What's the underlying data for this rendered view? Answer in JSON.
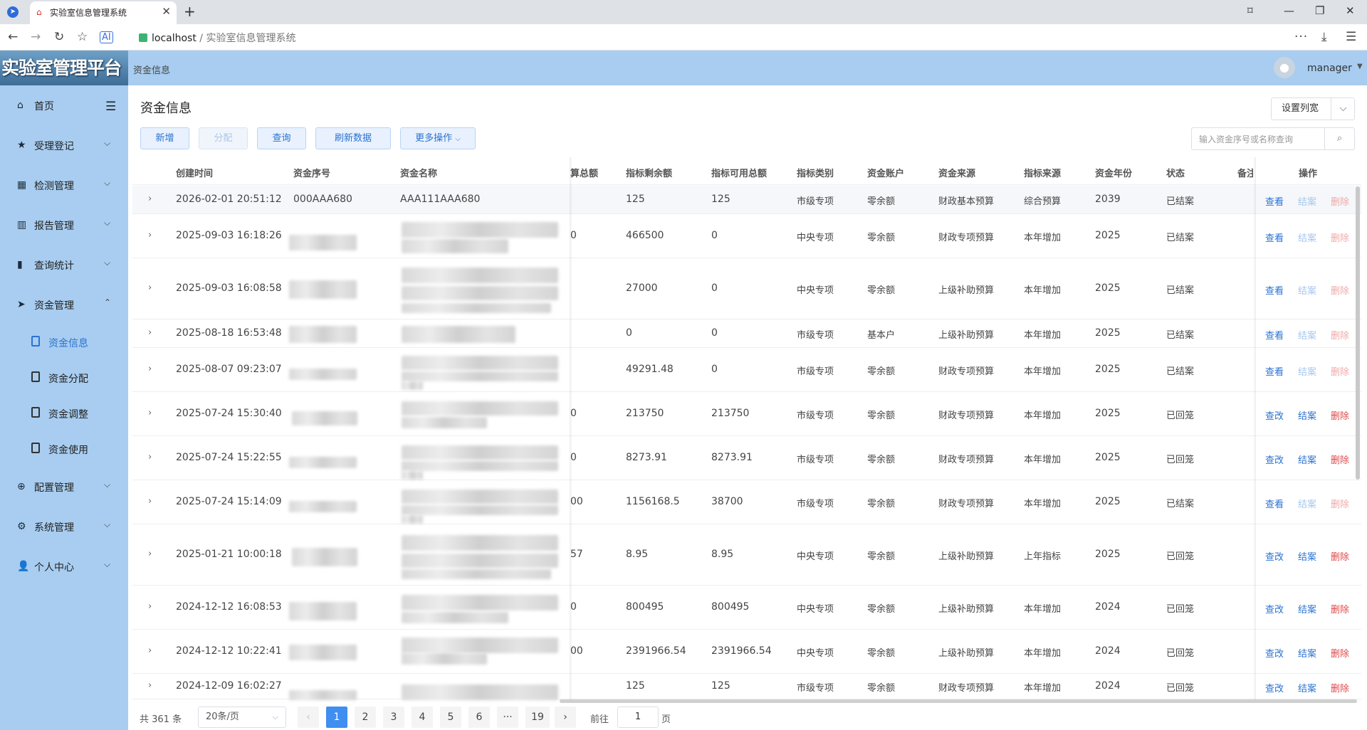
{
  "browser": {
    "tab_title": "实验室信息管理系统",
    "url_host": "localhost",
    "url_path": " / 实验室信息管理系统"
  },
  "header": {
    "logo_text": "实验室管理平台",
    "breadcrumb": "资金信息",
    "username": "manager"
  },
  "sidebar": {
    "items": [
      {
        "label": "首页",
        "icon": "home-icon"
      },
      {
        "label": "受理登记",
        "icon": "star-icon"
      },
      {
        "label": "检测管理",
        "icon": "grid-icon"
      },
      {
        "label": "报告管理",
        "icon": "report-icon"
      },
      {
        "label": "查询统计",
        "icon": "bar-chart-icon"
      },
      {
        "label": "资金管理",
        "icon": "send-icon"
      },
      {
        "label": "配置管理",
        "icon": "plus-circle-icon"
      },
      {
        "label": "系统管理",
        "icon": "gear-icon"
      },
      {
        "label": "个人中心",
        "icon": "user-icon"
      }
    ],
    "sub_items": [
      {
        "label": "资金信息",
        "active": true
      },
      {
        "label": "资金分配",
        "active": false
      },
      {
        "label": "资金调整",
        "active": false
      },
      {
        "label": "资金使用",
        "active": false
      }
    ]
  },
  "main": {
    "title": "资金信息",
    "buttons": {
      "add": "新增",
      "allocate": "分配",
      "query": "查询",
      "refresh": "刷新数据",
      "more": "更多操作"
    },
    "column_settings": "设置列宽",
    "search_placeholder": "输入资金序号或名称查询"
  },
  "table": {
    "headers": {
      "created": "创建时间",
      "fund_no": "资金序号",
      "fund_name": "资金名称",
      "budget_total": "算总额",
      "remaining": "指标剩余额",
      "available": "指标可用总额",
      "category": "指标类别",
      "account": "资金账户",
      "source": "资金来源",
      "indicator_source": "指标来源",
      "year": "资金年份",
      "status": "状态",
      "note": "备注",
      "ops": "操作"
    },
    "rows": [
      {
        "created": "2026-02-01 20:51:12",
        "fund_no": "000AAA680",
        "fund_name": "AAA111AAA680",
        "budget": "",
        "remaining": "125",
        "available": "125",
        "category": "市级专项",
        "account": "零余额",
        "source": "财政基本预算",
        "indicator_source": "综合预算",
        "year": "2039",
        "status": "已结案",
        "op1": "查看",
        "op2": "结案",
        "op3": "删除",
        "editable": false
      },
      {
        "created": "2025-09-03 16:18:26",
        "fund_no": "",
        "fund_name": "",
        "budget": "0",
        "remaining": "466500",
        "available": "0",
        "category": "中央专项",
        "account": "零余额",
        "source": "财政专项预算",
        "indicator_source": "本年增加",
        "year": "2025",
        "status": "已结案",
        "op1": "查看",
        "op2": "结案",
        "op3": "删除",
        "editable": false
      },
      {
        "created": "2025-09-03 16:08:58",
        "fund_no": "",
        "fund_name": "",
        "budget": "",
        "remaining": "27000",
        "available": "0",
        "category": "中央专项",
        "account": "零余额",
        "source": "上级补助预算",
        "indicator_source": "本年增加",
        "year": "2025",
        "status": "已结案",
        "op1": "查看",
        "op2": "结案",
        "op3": "删除",
        "editable": false
      },
      {
        "created": "2025-08-18 16:53:48",
        "fund_no": "",
        "fund_name": "",
        "budget": "",
        "remaining": "0",
        "available": "0",
        "category": "市级专项",
        "account": "基本户",
        "source": "上级补助预算",
        "indicator_source": "本年增加",
        "year": "2025",
        "status": "已结案",
        "op1": "查看",
        "op2": "结案",
        "op3": "删除",
        "editable": false
      },
      {
        "created": "2025-08-07 09:23:07",
        "fund_no": "",
        "fund_name": "",
        "budget": "",
        "remaining": "49291.48",
        "available": "0",
        "category": "市级专项",
        "account": "零余额",
        "source": "财政专项预算",
        "indicator_source": "本年增加",
        "year": "2025",
        "status": "已结案",
        "op1": "查看",
        "op2": "结案",
        "op3": "删除",
        "editable": false
      },
      {
        "created": "2025-07-24 15:30:40",
        "fund_no": "",
        "fund_name": "",
        "budget": "0",
        "remaining": "213750",
        "available": "213750",
        "category": "市级专项",
        "account": "零余额",
        "source": "财政专项预算",
        "indicator_source": "本年增加",
        "year": "2025",
        "status": "已回笼",
        "op1": "查改",
        "op2": "结案",
        "op3": "删除",
        "editable": true
      },
      {
        "created": "2025-07-24 15:22:55",
        "fund_no": "",
        "fund_name": "",
        "budget": "0",
        "remaining": "8273.91",
        "available": "8273.91",
        "category": "市级专项",
        "account": "零余额",
        "source": "财政专项预算",
        "indicator_source": "本年增加",
        "year": "2025",
        "status": "已回笼",
        "op1": "查改",
        "op2": "结案",
        "op3": "删除",
        "editable": true
      },
      {
        "created": "2025-07-24 15:14:09",
        "fund_no": "",
        "fund_name": "",
        "budget": "00",
        "remaining": "1156168.5",
        "available": "38700",
        "category": "市级专项",
        "account": "零余额",
        "source": "财政专项预算",
        "indicator_source": "本年增加",
        "year": "2025",
        "status": "已结案",
        "op1": "查看",
        "op2": "结案",
        "op3": "删除",
        "editable": false
      },
      {
        "created": "2025-01-21 10:00:18",
        "fund_no": "",
        "fund_name": "",
        "budget": "57",
        "remaining": "8.95",
        "available": "8.95",
        "category": "中央专项",
        "account": "零余额",
        "source": "上级补助预算",
        "indicator_source": "上年指标",
        "year": "2025",
        "status": "已回笼",
        "op1": "查改",
        "op2": "结案",
        "op3": "删除",
        "editable": true
      },
      {
        "created": "2024-12-12 16:08:53",
        "fund_no": "",
        "fund_name": "",
        "budget": "0",
        "remaining": "800495",
        "available": "800495",
        "category": "中央专项",
        "account": "零余额",
        "source": "上级补助预算",
        "indicator_source": "本年增加",
        "year": "2024",
        "status": "已回笼",
        "op1": "查改",
        "op2": "结案",
        "op3": "删除",
        "editable": true
      },
      {
        "created": "2024-12-12 10:22:41",
        "fund_no": "",
        "fund_name": "",
        "budget": "00",
        "remaining": "2391966.54",
        "available": "2391966.54",
        "category": "中央专项",
        "account": "零余额",
        "source": "上级补助预算",
        "indicator_source": "本年增加",
        "year": "2024",
        "status": "已回笼",
        "op1": "查改",
        "op2": "结案",
        "op3": "删除",
        "editable": true
      },
      {
        "created": "2024-12-09 16:02:27",
        "fund_no": "",
        "fund_name": "",
        "budget": "",
        "remaining": "125",
        "available": "125",
        "category": "市级专项",
        "account": "零余额",
        "source": "财政专项预算",
        "indicator_source": "本年增加",
        "year": "2024",
        "status": "已回笼",
        "op1": "查改",
        "op2": "结案",
        "op3": "删除",
        "editable": true
      }
    ]
  },
  "pagination": {
    "total": "共 361 条",
    "page_size": "20条/页",
    "pages": [
      "1",
      "2",
      "3",
      "4",
      "5",
      "6",
      "···",
      "19"
    ],
    "current": "1",
    "goto_label": "前往",
    "goto_value": "1",
    "page_unit": "页"
  },
  "colors": {
    "accent": "#2a72d1",
    "sidebar_bg": "#a8cdf0",
    "danger": "#e04848"
  }
}
